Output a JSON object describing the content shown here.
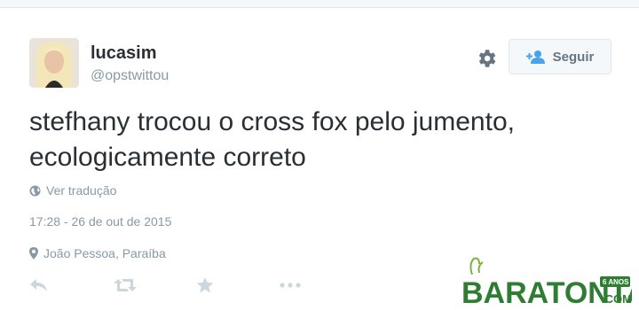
{
  "tweet": {
    "fullname": "lucasim",
    "username": "@opstwittou",
    "text_line1": "stefhany trocou o cross fox pelo jumento,",
    "text_line2": "ecologicamente correto",
    "translate_label": "Ver tradução",
    "timestamp": "17:28 - 26 de out de 2015",
    "location": "João Pessoa, Paraíba"
  },
  "header": {
    "follow_label": "Seguir"
  },
  "actions": {
    "icons": [
      "reply-icon",
      "retweet-icon",
      "favorite-icon",
      "more-icon"
    ]
  },
  "watermark": {
    "brand": "BARATONTA",
    "badge": "6 ANOS",
    "suffix": ".COM"
  },
  "colors": {
    "text": "#292f33",
    "muted": "#8899a6",
    "icon": "#ccd6dd",
    "brand_green": "#2e7d32"
  }
}
